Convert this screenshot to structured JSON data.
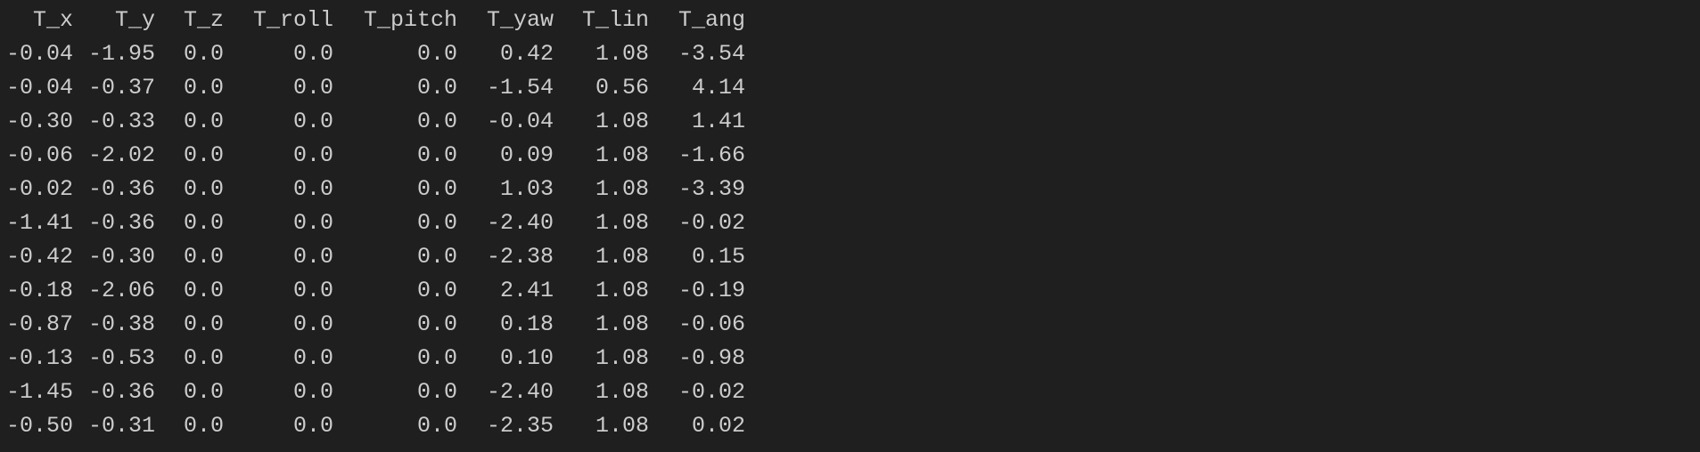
{
  "table": {
    "columns": [
      "T_x",
      "T_y",
      "T_z",
      "T_roll",
      "T_pitch",
      "T_yaw",
      "T_lin",
      "T_ang"
    ],
    "rows": [
      [
        "-0.04",
        "-1.95",
        "0.0",
        "0.0",
        "0.0",
        "0.42",
        "1.08",
        "-3.54"
      ],
      [
        "-0.04",
        "-0.37",
        "0.0",
        "0.0",
        "0.0",
        "-1.54",
        "0.56",
        "4.14"
      ],
      [
        "-0.30",
        "-0.33",
        "0.0",
        "0.0",
        "0.0",
        "-0.04",
        "1.08",
        "1.41"
      ],
      [
        "-0.06",
        "-2.02",
        "0.0",
        "0.0",
        "0.0",
        "0.09",
        "1.08",
        "-1.66"
      ],
      [
        "-0.02",
        "-0.36",
        "0.0",
        "0.0",
        "0.0",
        "1.03",
        "1.08",
        "-3.39"
      ],
      [
        "-1.41",
        "-0.36",
        "0.0",
        "0.0",
        "0.0",
        "-2.40",
        "1.08",
        "-0.02"
      ],
      [
        "-0.42",
        "-0.30",
        "0.0",
        "0.0",
        "0.0",
        "-2.38",
        "1.08",
        "0.15"
      ],
      [
        "-0.18",
        "-2.06",
        "0.0",
        "0.0",
        "0.0",
        "2.41",
        "1.08",
        "-0.19"
      ],
      [
        "-0.87",
        "-0.38",
        "0.0",
        "0.0",
        "0.0",
        "0.18",
        "1.08",
        "-0.06"
      ],
      [
        "-0.13",
        "-0.53",
        "0.0",
        "0.0",
        "0.0",
        "0.10",
        "1.08",
        "-0.98"
      ],
      [
        "-1.45",
        "-0.36",
        "0.0",
        "0.0",
        "0.0",
        "-2.40",
        "1.08",
        "-0.02"
      ],
      [
        "-0.50",
        "-0.31",
        "0.0",
        "0.0",
        "0.0",
        "-2.35",
        "1.08",
        "0.02"
      ]
    ]
  },
  "colors": {
    "background": "#1f1f1f",
    "text": "#cccccc"
  }
}
